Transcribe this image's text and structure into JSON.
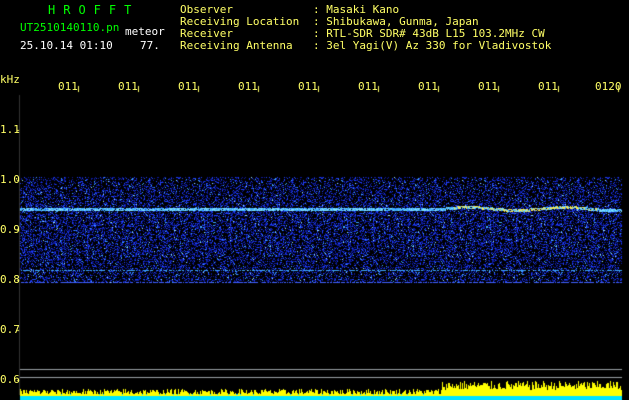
{
  "header": {
    "app_title": "HROFFT",
    "filename": "UT2510140110.pn",
    "mode": "meteor",
    "datetime": "25.10.14 01:10",
    "code": "77.",
    "info": [
      {
        "label": "Observer",
        "value": ": Masaki Kano"
      },
      {
        "label": "Receiving Location",
        "value": ": Shibukawa, Gunma, Japan"
      },
      {
        "label": "Receiver",
        "value": ": RTL-SDR SDR# 43dB L15 103.2MHz CW"
      },
      {
        "label": "Receiving Antenna",
        "value": ": 3el Yagi(V) Az 330 for Vladivostok"
      }
    ]
  },
  "axis": {
    "y_unit": "kHz",
    "y_ticks": [
      "1.1",
      "1.0",
      "0.9",
      "0.8",
      "0.7",
      "0.6"
    ],
    "y_range": [
      0.6,
      1.2
    ],
    "x_ticks": [
      "011",
      "011",
      "011",
      "011",
      "011",
      "011",
      "011",
      "011",
      "011",
      "0120"
    ]
  },
  "signal": {
    "band_low_khz": 0.795,
    "band_high_khz": 1.005,
    "carrier_khz": 0.943,
    "secondary_carrier_khz": 0.82
  },
  "colors": {
    "background": "#000000",
    "text": "#ffffff",
    "accent_green": "#00ff00",
    "tick_yellow": "#ffff66",
    "noise_blue": "#1e3cff",
    "baseline_cyan": "#00e5ff",
    "bar_yellow": "#ffff00"
  }
}
